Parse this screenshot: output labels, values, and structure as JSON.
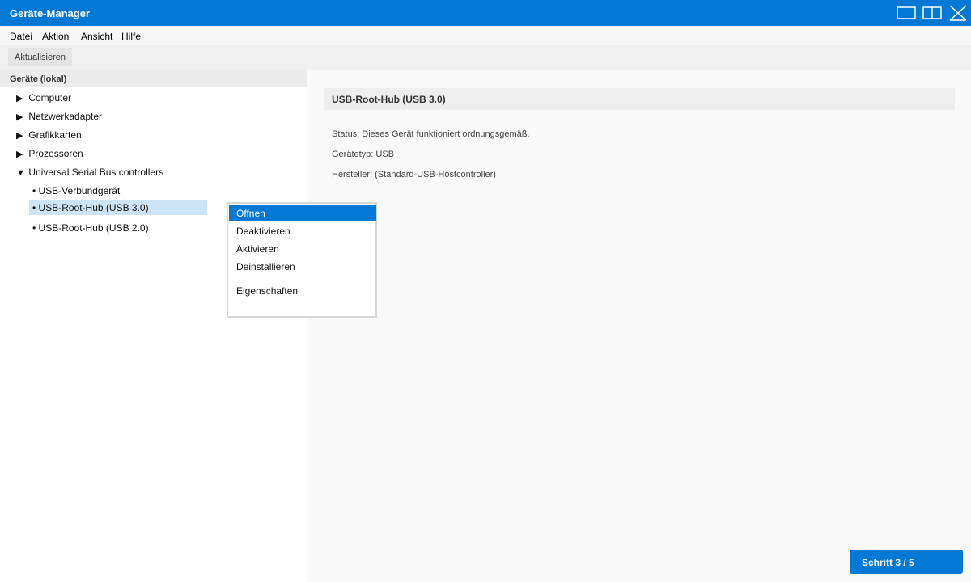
{
  "window": {
    "title": "Geräte-Manager",
    "controls": [
      "restore-icon",
      "split-view-icon",
      "close-icon"
    ]
  },
  "menubar": {
    "items": [
      "Datei",
      "Aktion",
      "Ansicht",
      "Hilfe"
    ]
  },
  "toolbar": {
    "refresh_label": "Aktualisieren"
  },
  "tree": {
    "header": "Geräte (lokal)",
    "categories": [
      {
        "label": "Computer",
        "expanded": false
      },
      {
        "label": "Netzwerkadapter",
        "expanded": false
      },
      {
        "label": "Grafikkarten",
        "expanded": false
      },
      {
        "label": "Prozessoren",
        "expanded": false
      },
      {
        "label": "Universal Serial Bus controllers",
        "expanded": true
      }
    ],
    "usb_children": [
      {
        "label": "• USB-Verbundgerät",
        "selected": false
      },
      {
        "label": "• USB-Root-Hub (USB 3.0)",
        "selected": true
      },
      {
        "label": "• USB-Root-Hub (USB 2.0)",
        "selected": false
      }
    ],
    "collapsed_arrow": "▶",
    "expanded_arrow": "▼"
  },
  "details": {
    "title": "USB-Root-Hub (USB 3.0)",
    "status": "Status: Dieses Gerät funktioniert ordnungsgemäß.",
    "type": "Gerätetyp: USB",
    "manufacturer": "Hersteller: (Standard-USB-Hostcontroller)"
  },
  "context_menu": {
    "items": [
      "Öffnen",
      "Deaktivieren",
      "Aktivieren",
      "Deinstallieren"
    ],
    "active_index": 0,
    "properties": "Eigenschaften"
  },
  "step": {
    "label": "Schritt 3 / 5"
  },
  "colors": {
    "accent": "#0078d4",
    "selection": "#cce4f7"
  }
}
